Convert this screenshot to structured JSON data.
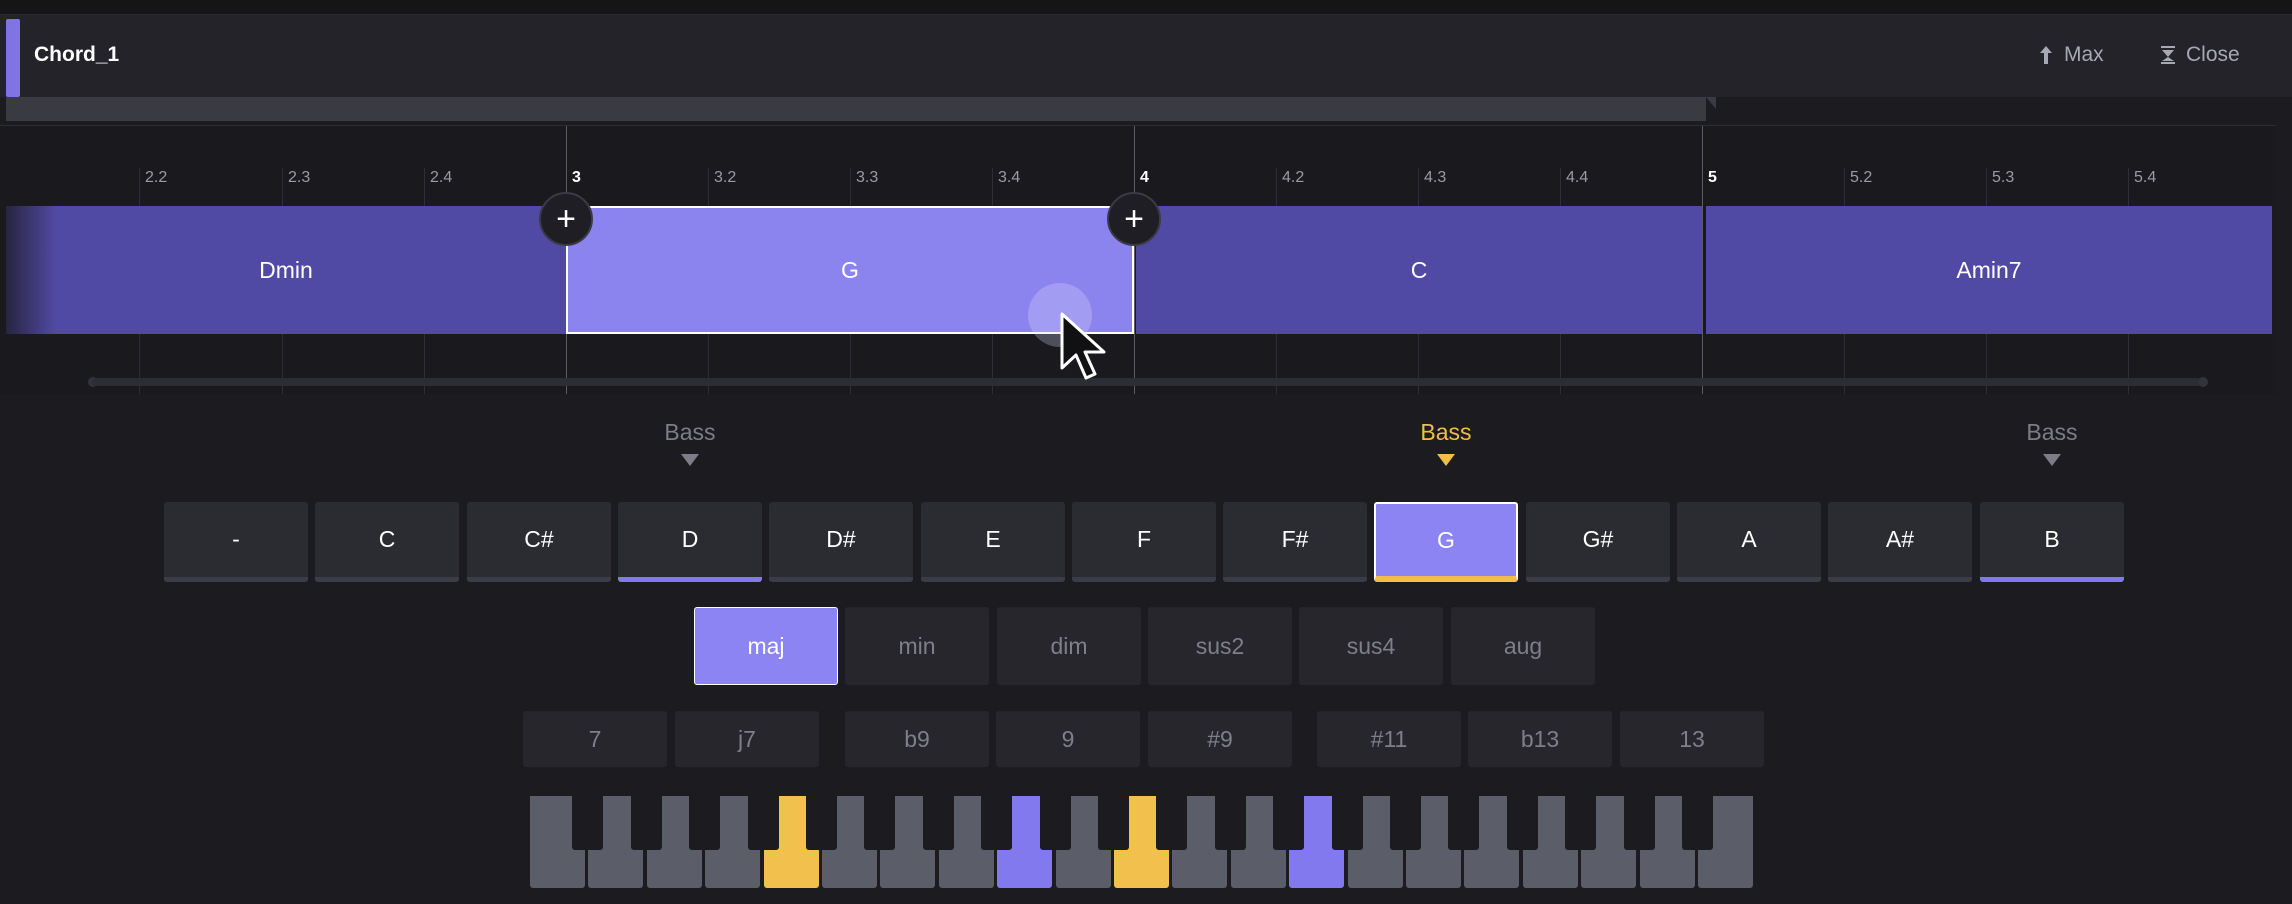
{
  "window": {
    "title": "Chord_1",
    "max_label": "Max",
    "close_label": "Close",
    "accent_color": "#7f74e2"
  },
  "timeline": {
    "ticks": [
      "2.2",
      "2.3",
      "2.4",
      "3",
      "3.2",
      "3.3",
      "3.4",
      "4",
      "4.2",
      "4.3",
      "4.4",
      "5",
      "5.2",
      "5.3",
      "5.4"
    ],
    "chords": [
      {
        "label": "Dmin",
        "selected": false
      },
      {
        "label": "G",
        "selected": true
      },
      {
        "label": "C",
        "selected": false
      },
      {
        "label": "Amin7",
        "selected": false
      }
    ],
    "add_icon_label": "+"
  },
  "bass_markers": [
    {
      "label": "Bass",
      "active": false
    },
    {
      "label": "Bass",
      "active": true
    },
    {
      "label": "Bass",
      "active": false
    }
  ],
  "roots": [
    "-",
    "C",
    "C#",
    "D",
    "D#",
    "E",
    "F",
    "F#",
    "G",
    "G#",
    "A",
    "A#",
    "B"
  ],
  "root_selected": "G",
  "qualities": [
    "maj",
    "min",
    "dim",
    "sus2",
    "sus4",
    "aug"
  ],
  "quality_selected": "maj",
  "extensions": [
    "7",
    "j7",
    "b9",
    "9",
    "#9",
    "#11",
    "b13",
    "13"
  ],
  "colors": {
    "chord_block": "#514aa4",
    "chord_selected": "#8c84ee",
    "bass_active": "#f2be4a",
    "note_highlight": "#8279ee"
  }
}
